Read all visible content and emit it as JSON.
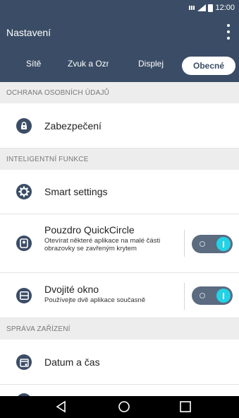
{
  "status_bar": {
    "time": "12:00"
  },
  "app_bar": {
    "title": "Nastavení",
    "menu_icon": "overflow-menu-icon"
  },
  "tabs": [
    {
      "label": "Sítě",
      "active": false
    },
    {
      "label": "Zvuk a Ozn",
      "active": false
    },
    {
      "label": "Displej",
      "active": false
    },
    {
      "label": "Obecné",
      "active": true
    }
  ],
  "sections": {
    "privacy": "OCHRANA OSOBNÍCH ÚDAJŮ",
    "smart": "INTELIGENTNÍ FUNKCE",
    "device": "SPRÁVA ZAŘÍZENÍ"
  },
  "items": {
    "security": {
      "title": "Zabezpečení",
      "icon": "lock-icon"
    },
    "smart_settings": {
      "title": "Smart settings",
      "icon": "gear-icon"
    },
    "quickcircle": {
      "title": "Pouzdro QuickCircle",
      "subtitle": "Otevírat některé aplikace na malé části obrazovky se zavřeným krytem",
      "icon": "cover-case-icon",
      "enabled": true
    },
    "dual_window": {
      "title": "Dvojité okno",
      "subtitle": "Používejte dvě aplikace současně",
      "icon": "dual-window-icon",
      "enabled": true
    },
    "date_time": {
      "title": "Datum a čas",
      "icon": "calendar-clock-icon"
    }
  },
  "nav_bar": {
    "back": "back-icon",
    "home": "home-icon",
    "recents": "recents-icon"
  },
  "colors": {
    "primary": "#3b4d66",
    "toggle_on": "#22d3e6",
    "section_bg": "#ededed"
  }
}
